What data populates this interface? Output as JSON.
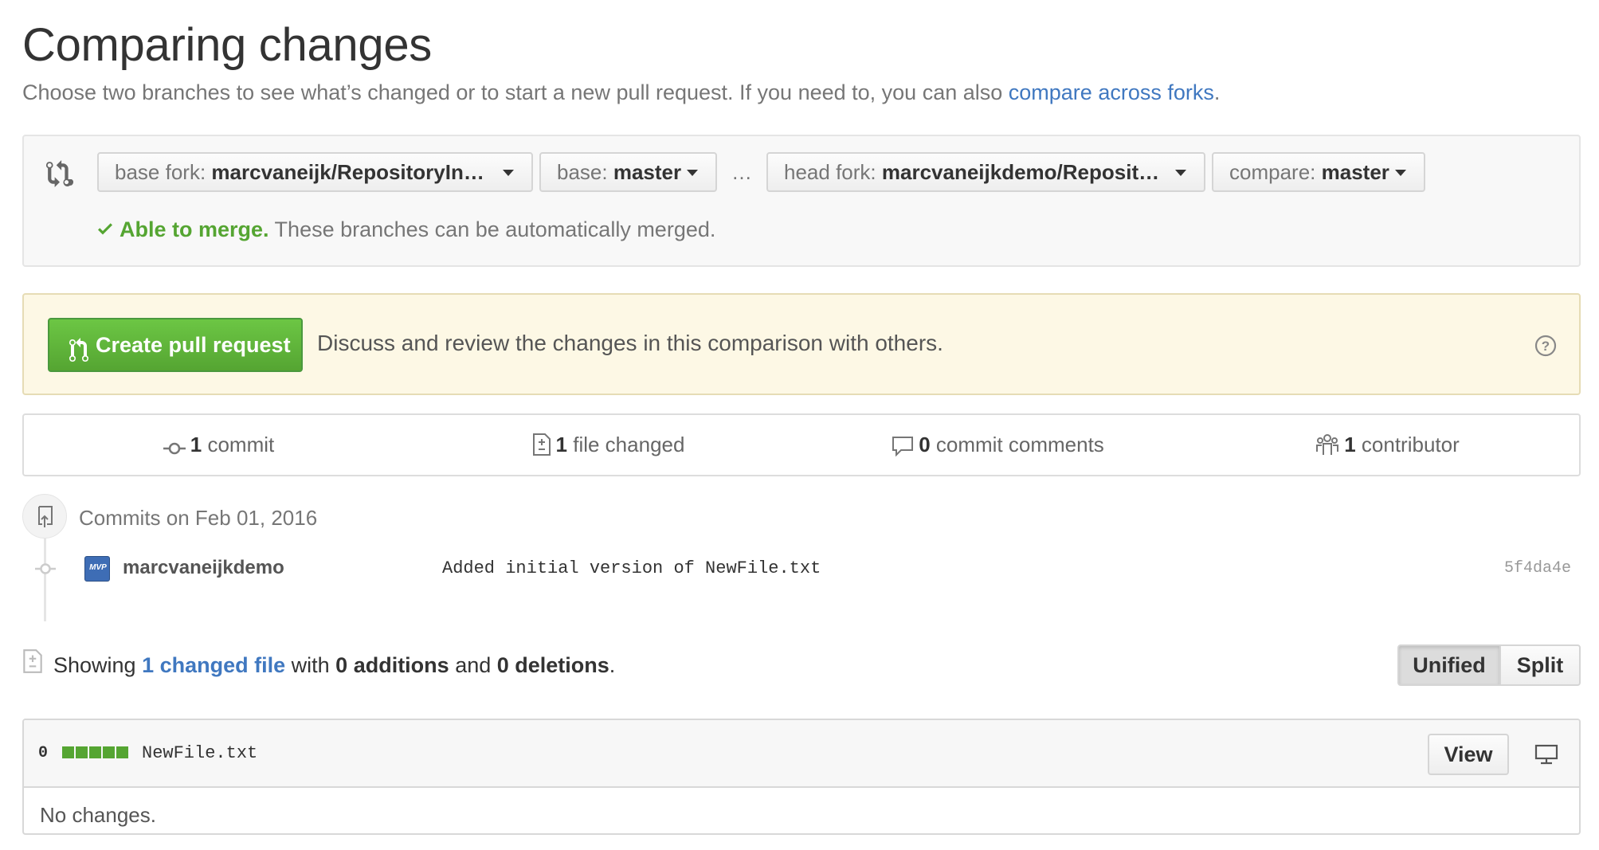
{
  "header": {
    "title": "Comparing changes",
    "subtitle_text": "Choose two branches to see what’s changed or to start a new pull request. If you need to, you can also ",
    "subtitle_link": "compare across forks",
    "subtitle_end": "."
  },
  "range": {
    "base_fork_label": "base fork:",
    "base_fork_value": "marcvaneijk/RepositoryIn…",
    "base_label": "base:",
    "base_value": "master",
    "separator": "…",
    "head_fork_label": "head fork:",
    "head_fork_value": "marcvaneijkdemo/Reposit…",
    "compare_label": "compare:",
    "compare_value": "master",
    "merge_ok": "Able to merge.",
    "merge_text": " These branches can be automatically merged."
  },
  "pull_request": {
    "button_label": "Create pull request",
    "description": "Discuss and review the changes in this comparison with others."
  },
  "summary": {
    "commits_count": "1",
    "commits_label": " commit",
    "files_count": "1",
    "files_label": " file changed",
    "comments_count": "0",
    "comments_label": " commit comments",
    "contributors_count": "1",
    "contributors_label": " contributor"
  },
  "commits": {
    "day_label": "Commits on Feb 01, 2016",
    "items": [
      {
        "author": "marcvaneijkdemo",
        "avatar_text": "MVP",
        "message": "Added initial version of NewFile.txt",
        "sha": "5f4da4e"
      }
    ]
  },
  "diff_toolbar": {
    "showing": "Showing ",
    "changed_files_link": "1 changed file",
    "with": " with ",
    "additions": "0 additions",
    "and": " and ",
    "deletions": "0 deletions",
    "end": ".",
    "unified_label": "Unified",
    "split_label": "Split"
  },
  "file": {
    "diffstat_count": "0",
    "diffstat_blocks": 5,
    "name": "NewFile.txt",
    "view_label": "View",
    "body_text": "No changes."
  },
  "colors": {
    "link": "#4078c0",
    "success": "#55a532",
    "warn_bg": "#fdf8e5"
  }
}
